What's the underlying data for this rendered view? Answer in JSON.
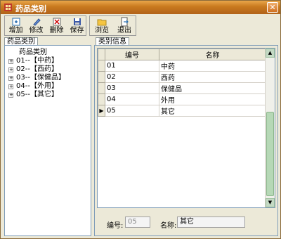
{
  "window": {
    "title": "药品类别"
  },
  "toolbar": {
    "add": "增加",
    "edit": "修改",
    "delete": "删除",
    "save": "保存",
    "browse": "浏览",
    "exit": "退出"
  },
  "tabs": {
    "left": "药品类别",
    "right": "类别信息"
  },
  "tree": {
    "root": "药品类别",
    "items": [
      "01--【中药】",
      "02--【西药】",
      "03--【保健品】",
      "04--【外用】",
      "05--【其它】"
    ]
  },
  "grid": {
    "headers": [
      "编号",
      "名称"
    ],
    "rows": [
      {
        "code": "01",
        "name": "中药"
      },
      {
        "code": "02",
        "name": "西药"
      },
      {
        "code": "03",
        "name": "保健品"
      },
      {
        "code": "04",
        "name": "外用"
      },
      {
        "code": "05",
        "name": "其它"
      }
    ],
    "current_row_marker": "▶"
  },
  "form": {
    "code_label": "编号:",
    "code_value": "05",
    "name_label": "名称:",
    "name_value": "其它"
  },
  "colors": {
    "titlebar": "#c8791e",
    "panel_border": "#7f9db9",
    "scroll": "#b6d8b6"
  }
}
